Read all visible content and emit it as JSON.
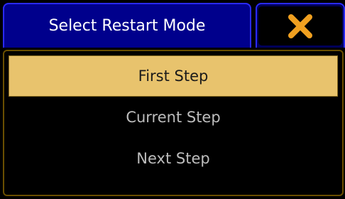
{
  "dialog": {
    "title": "Select Restart Mode",
    "close_icon": "close-x-icon",
    "close_color": "#f0a020",
    "options": [
      {
        "label": "First Step",
        "selected": true
      },
      {
        "label": "Current Step",
        "selected": false
      },
      {
        "label": "Next Step",
        "selected": false
      }
    ]
  },
  "colors": {
    "title_bg": "#00008c",
    "selected_bg": "#e8c36d",
    "option_text": "#bdbdbd"
  }
}
